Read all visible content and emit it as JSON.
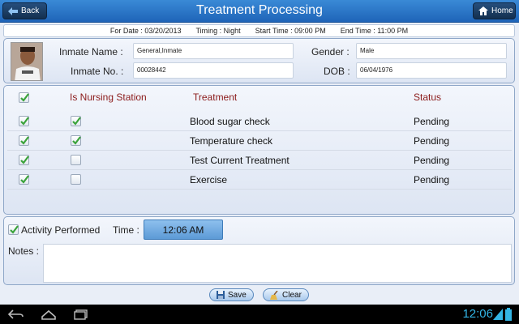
{
  "header": {
    "title": "Treatment Processing",
    "back_label": "Back",
    "home_label": "Home"
  },
  "info": {
    "for_date": "For Date : 03/20/2013",
    "timing": "Timing : Night",
    "start_time": "Start Time : 09:00 PM",
    "end_time": "End Time : 11:00 PM"
  },
  "inmate": {
    "name_label": "Inmate Name :",
    "name_value": "General,Inmate",
    "no_label": "Inmate No. :",
    "no_value": "00028442",
    "gender_label": "Gender :",
    "gender_value": "Male",
    "dob_label": "DOB :",
    "dob_value": "06/04/1976"
  },
  "table": {
    "headers": {
      "nursing": "Is Nursing Station",
      "treatment": "Treatment",
      "status": "Status"
    },
    "select_all_checked": true,
    "rows": [
      {
        "selected": true,
        "nursing": true,
        "treatment": "Blood sugar check",
        "status": "Pending"
      },
      {
        "selected": true,
        "nursing": true,
        "treatment": "Temperature check",
        "status": "Pending"
      },
      {
        "selected": true,
        "nursing": false,
        "treatment": "Test Current Treatment",
        "status": "Pending"
      },
      {
        "selected": true,
        "nursing": false,
        "treatment": "Exercise",
        "status": "Pending"
      }
    ]
  },
  "activity": {
    "checkbox_checked": true,
    "activity_label": "Activity Performed",
    "time_label": "Time :",
    "time_value": "12:06 AM",
    "notes_label": "Notes :",
    "notes_value": ""
  },
  "actions": {
    "save_label": "Save",
    "clear_label": "Clear"
  },
  "system": {
    "clock": "12:06"
  },
  "colors": {
    "titlebar": "#2a78cc",
    "header_text": "#8b1a1a",
    "check_green": "#3aa33a",
    "clock_blue": "#33b5e5"
  }
}
